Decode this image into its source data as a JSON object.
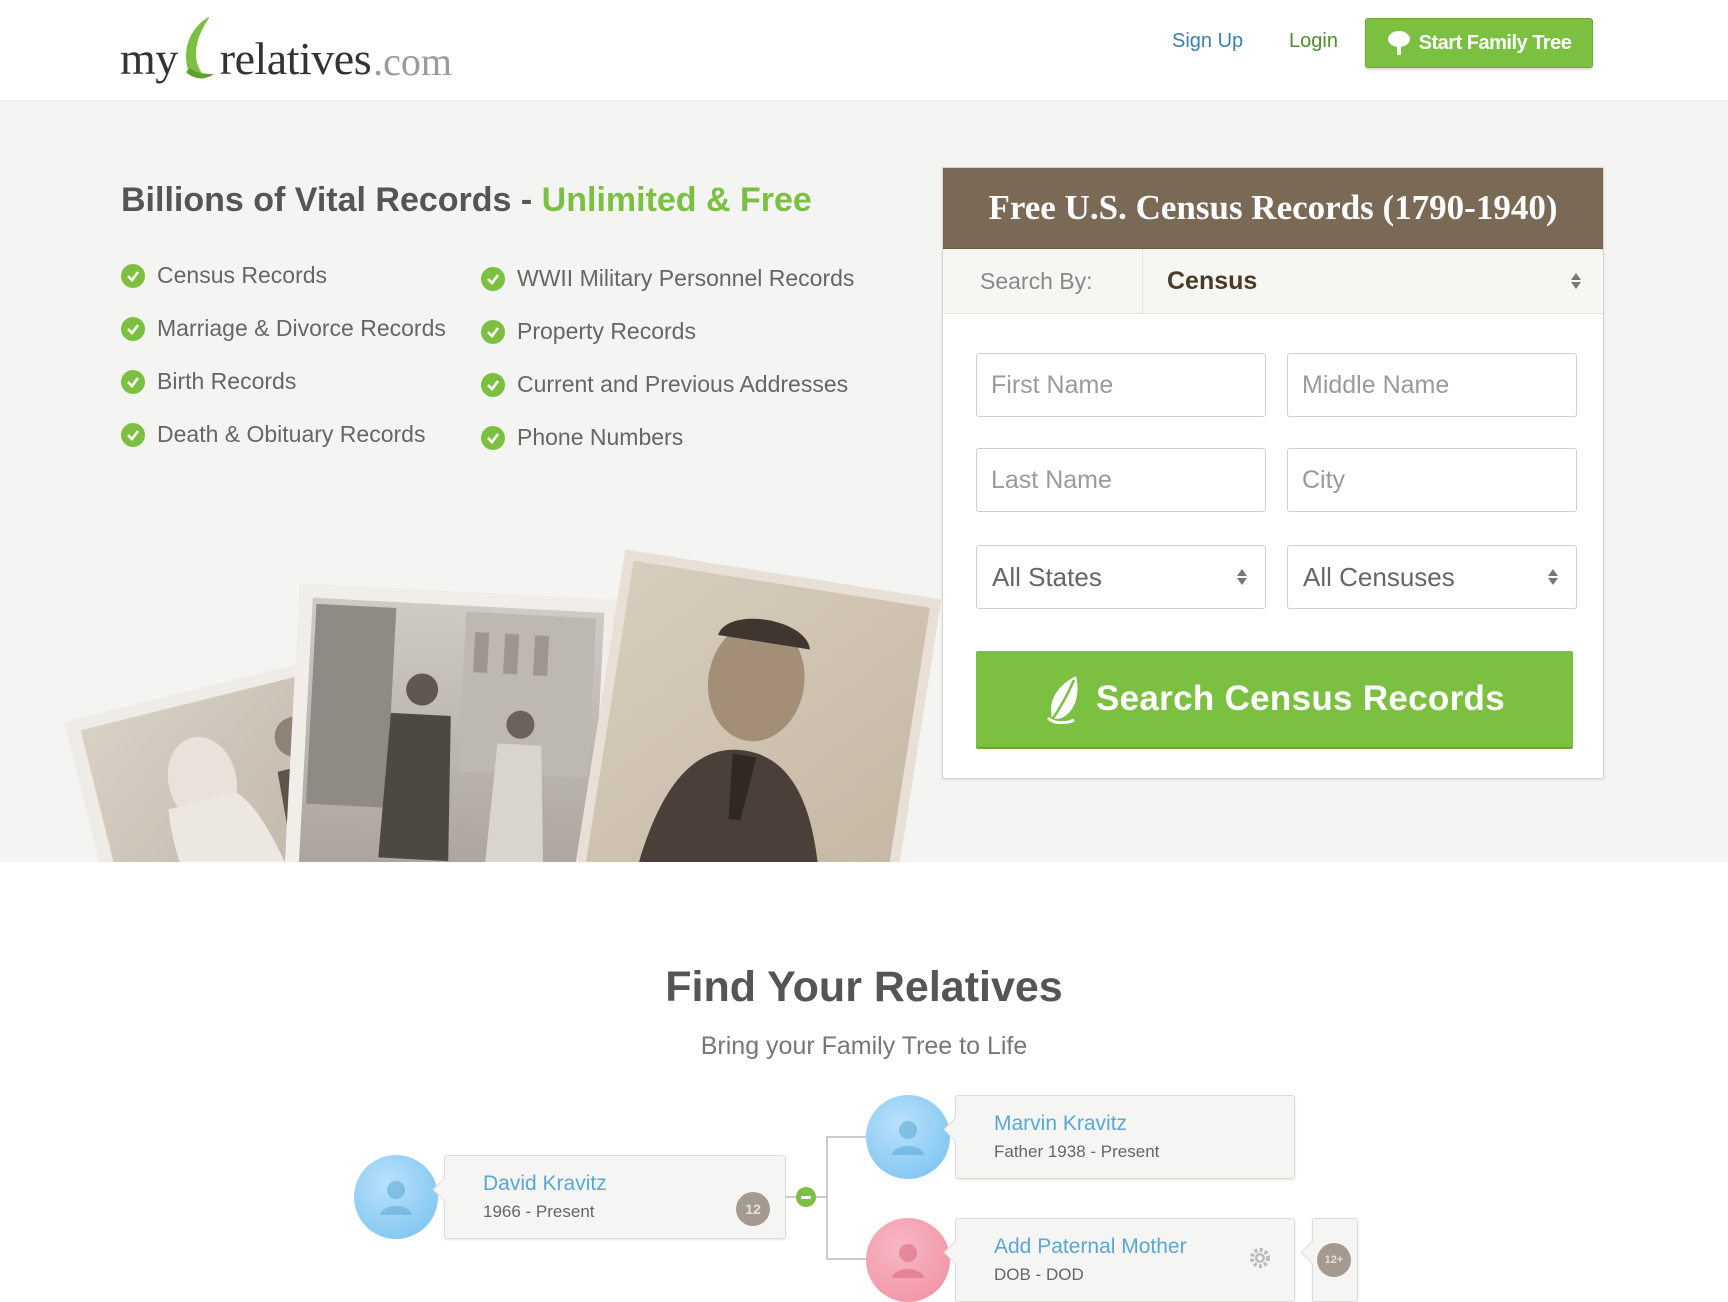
{
  "header": {
    "logo": {
      "part1": "my",
      "part2": "relatives",
      "part3": ".com"
    },
    "signup_label": "Sign Up",
    "login_label": "Login",
    "start_label": "Start Family Tree"
  },
  "hero": {
    "title_main": "Billions of Vital Records - ",
    "title_accent": "Unlimited & Free",
    "features_left": [
      "Census Records",
      "Marriage & Divorce Records",
      "Birth Records",
      "Death & Obituary Records"
    ],
    "features_right": [
      "WWII Military Personnel Records",
      "Property Records",
      "Current and Previous Addresses",
      "Phone Numbers"
    ]
  },
  "search_panel": {
    "title": "Free U.S. Census Records (1790-1940)",
    "search_by_label": "Search By:",
    "search_by_value": "Census",
    "first_name_placeholder": "First Name",
    "middle_name_placeholder": "Middle Name",
    "last_name_placeholder": "Last Name",
    "city_placeholder": "City",
    "state_value": "All States",
    "census_value": "All Censuses",
    "button_label": "Search Census Records"
  },
  "relatives": {
    "title": "Find Your Relatives",
    "subtitle": "Bring your Family Tree to Life",
    "people": [
      {
        "name": "David Kravitz",
        "dates": "1966 - Present",
        "badge": "12"
      },
      {
        "name": "Marvin Kravitz",
        "dates": "Father 1938 - Present"
      },
      {
        "name": "Add Paternal Mother",
        "dates": "DOB - DOD",
        "badge": "12+"
      }
    ]
  },
  "colors": {
    "accent_green": "#7cc042",
    "panel_brown": "#7a6a55",
    "link_blue": "#3b7fb0",
    "name_blue": "#5aa7d6"
  },
  "icons": [
    "leaf-logo-icon",
    "tree-icon",
    "check-circle-icon",
    "select-arrows-icon",
    "leaf-button-icon",
    "person-icon",
    "gear-icon",
    "minus-icon"
  ]
}
